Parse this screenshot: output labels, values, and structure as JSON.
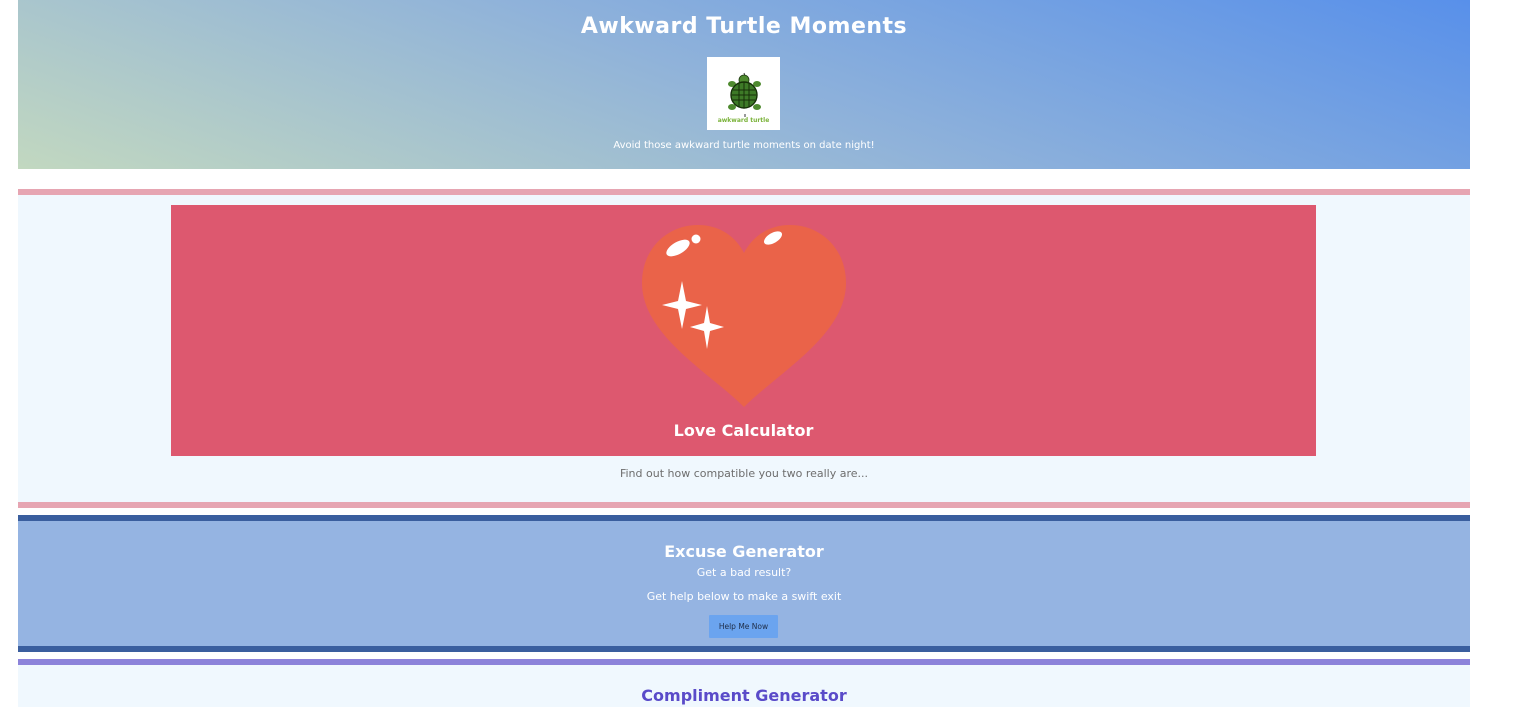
{
  "header": {
    "title": "Awkward Turtle Moments",
    "logo_icon": "turtle-logo-icon",
    "logo_text": "awkward turtle",
    "tagline": "Avoid those awkward turtle moments on date night!"
  },
  "love": {
    "icon": "heart-sparkle-icon",
    "title": "Love Calculator",
    "description": "Find out how compatible you two really are..."
  },
  "excuse": {
    "title": "Excuse Generator",
    "line1": "Get a bad result?",
    "line2": "Get help below to make a swift exit",
    "button_label": "Help Me Now"
  },
  "compliment": {
    "title": "Compliment Generator"
  },
  "colors": {
    "header_gradient_start": "#c2d8c0",
    "header_gradient_end": "#5890ea",
    "love_card": "#dd586f",
    "love_border": "#e6a5b2",
    "heart": "#ea6349",
    "excuse_bg": "#95b4e2",
    "excuse_border": "#3a5e9e",
    "button": "#6ba4ef",
    "compliment_border": "#8c83da",
    "compliment_title": "#5a4bc9",
    "section_bg": "#f0f8fe"
  }
}
